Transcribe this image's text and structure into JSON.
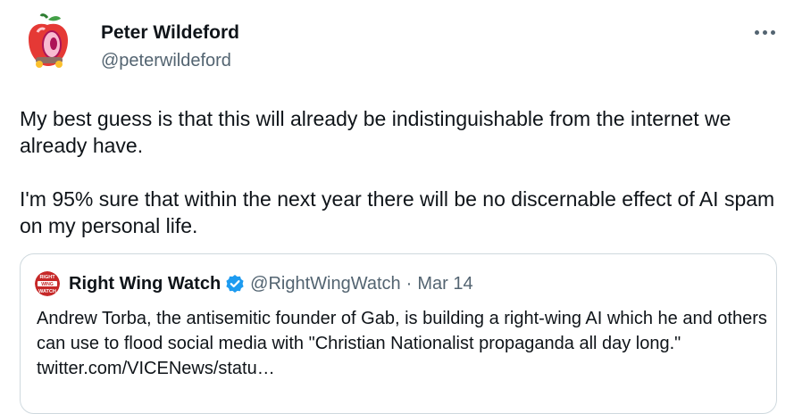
{
  "tweet": {
    "author": {
      "name": "Peter Wildeford",
      "handle": "@peterwildeford"
    },
    "more_label": "More",
    "text": "My best guess is that this will already be indistinguishable from the internet we already have.\n\nI'm 95% sure that within the next year there will be no discernable effect of AI spam on my personal life.",
    "quoted": {
      "author_name": "Right Wing Watch",
      "handle": "@RightWingWatch",
      "separator": "·",
      "date": "Mar 14",
      "avatar_text": [
        "RIGHT",
        "WING",
        "WATCH"
      ],
      "text": "Andrew Torba, the antisemitic founder of Gab, is building a right-wing AI which he and others can use to flood social media with \"Christian Nationalist propaganda all day long.\"",
      "link": "twitter.com/VICENews/statu…"
    }
  },
  "colors": {
    "text": "#0f1419",
    "secondary": "#536471",
    "border": "#cfd9de",
    "verified": "#1d9bf0"
  }
}
